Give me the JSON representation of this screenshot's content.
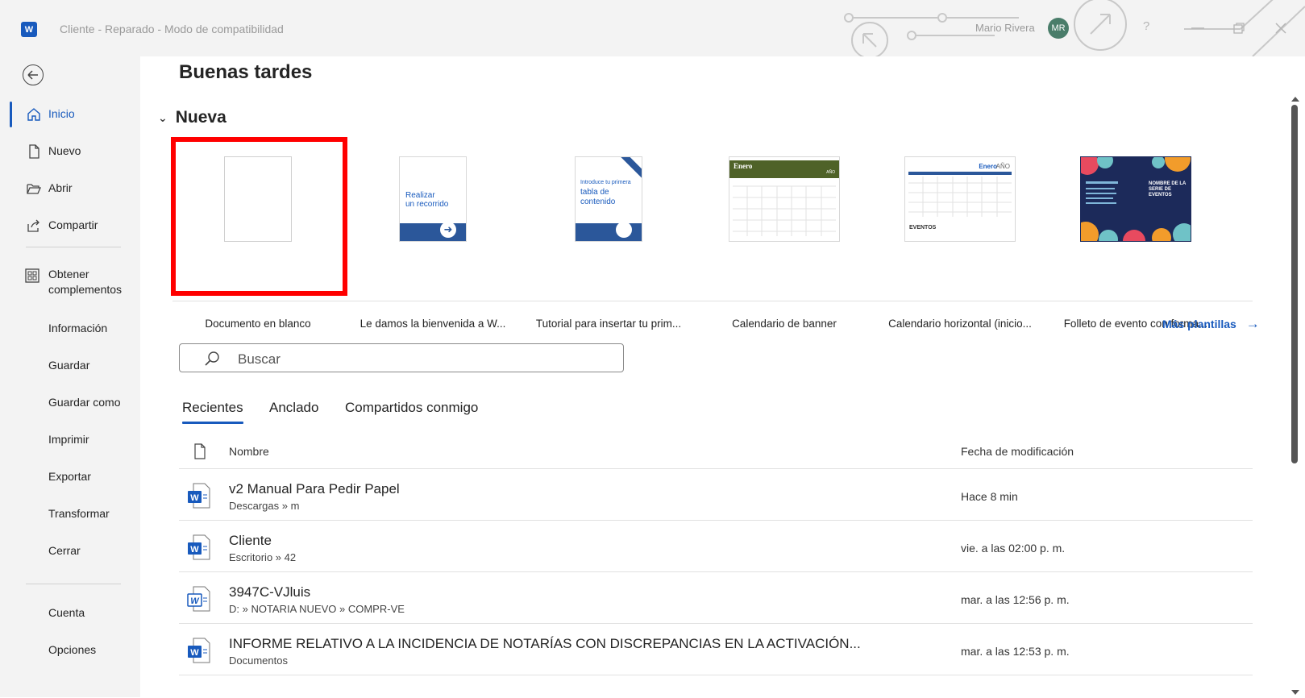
{
  "titlebar": {
    "app_logo": "W",
    "doc_title": "Cliente  -  Reparado  -  Modo de compatibilidad",
    "user_name": "Mario  Rivera",
    "avatar_initials": "MR",
    "help": "?"
  },
  "sidebar": {
    "items": [
      {
        "label": "Inicio",
        "icon": "home-icon"
      },
      {
        "label": "Nuevo",
        "icon": "new-document-icon"
      },
      {
        "label": "Abrir",
        "icon": "folder-open-icon"
      },
      {
        "label": "Compartir",
        "icon": "share-icon"
      },
      {
        "label": "Obtener",
        "label2": "complementos",
        "icon": "addins-icon"
      },
      {
        "label": "Información"
      },
      {
        "label": "Guardar"
      },
      {
        "label": "Guardar como"
      },
      {
        "label": "Imprimir"
      },
      {
        "label": "Exportar"
      },
      {
        "label": "Transformar"
      },
      {
        "label": "Cerrar"
      },
      {
        "label": "Cuenta"
      },
      {
        "label": "Opciones"
      }
    ]
  },
  "main": {
    "greeting": "Buenas tardes",
    "section_new": "Nueva",
    "templates": [
      {
        "name": "Documento en blanco"
      },
      {
        "name": "Le damos la bienvenida a W...",
        "thumb_text": "Realizar\nun recorrido"
      },
      {
        "name": "Tutorial para insertar tu prim...",
        "thumb_line1": "Introduce tu primera",
        "thumb_line2": "tabla de",
        "thumb_line3": "contenido"
      },
      {
        "name": "Calendario de banner",
        "thumb_month": "Enero",
        "thumb_year": "AÑO"
      },
      {
        "name": "Calendario horizontal (inicio...",
        "thumb_month": "Enero",
        "thumb_year": "AÑO",
        "thumb_events": "EVENTOS"
      },
      {
        "name": "Folleto de evento con forma...",
        "thumb_title": "NOMBRE DE LA SERIE DE EVENTOS"
      }
    ],
    "more_templates": "Más plantillas",
    "search_placeholder": "Buscar",
    "tabs": [
      "Recientes",
      "Anclado",
      "Compartidos conmigo"
    ],
    "columns": {
      "name": "Nombre",
      "date": "Fecha de modificación"
    },
    "files": [
      {
        "name": "v2 Manual Para Pedir Papel",
        "path": "Descargas » m",
        "date": "Hace 8 min"
      },
      {
        "name": "Cliente",
        "path": "Escritorio » 42",
        "date": "vie. a las 02:00 p. m."
      },
      {
        "name": "3947C-VJluis",
        "path": "D: » NOTARIA NUEVO » COMPR-VE",
        "date": "mar. a las 12:56 p. m."
      },
      {
        "name": "INFORME RELATIVO A LA INCIDENCIA DE NOTARÍAS CON DISCREPANCIAS EN LA ACTIVACIÓN...",
        "path": "Documentos",
        "date": "mar. a las 12:53 p. m."
      }
    ]
  },
  "colors": {
    "accent": "#185abd",
    "highlight": "#ff0000",
    "sidebar_bg": "#f3f3f3"
  }
}
